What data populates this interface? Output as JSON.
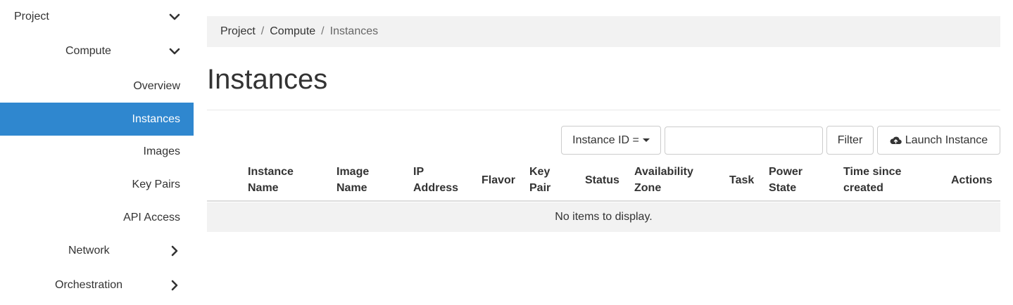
{
  "sidebar": {
    "project_label": "Project",
    "compute_label": "Compute",
    "items": [
      {
        "label": "Overview"
      },
      {
        "label": "Instances"
      },
      {
        "label": "Images"
      },
      {
        "label": "Key Pairs"
      },
      {
        "label": "API Access"
      }
    ],
    "network_label": "Network",
    "orchestration_label": "Orchestration",
    "active_item": "Instances",
    "icons": {
      "expanded": "chevron-down-icon",
      "collapsed": "chevron-right-icon"
    }
  },
  "breadcrumb": {
    "items": [
      "Project",
      "Compute",
      "Instances"
    ],
    "separator": "/"
  },
  "page": {
    "title": "Instances"
  },
  "toolbar": {
    "filter_field_label": "Instance ID =",
    "filter_value": "",
    "filter_button_label": "Filter",
    "launch_button_label": "Launch Instance",
    "launch_icon": "cloud-upload-icon"
  },
  "table": {
    "columns": [
      {
        "line1": "Instance",
        "line2": "Name"
      },
      {
        "line1": "Image",
        "line2": "Name"
      },
      {
        "line1": "IP",
        "line2": "Address"
      },
      {
        "line1": "Flavor",
        "line2": ""
      },
      {
        "line1": "Key",
        "line2": "Pair"
      },
      {
        "line1": "Status",
        "line2": ""
      },
      {
        "line1": "Availability",
        "line2": "Zone"
      },
      {
        "line1": "Task",
        "line2": ""
      },
      {
        "line1": "Power",
        "line2": "State"
      },
      {
        "line1": "Time since",
        "line2": "created"
      },
      {
        "line1": "Actions",
        "line2": ""
      }
    ],
    "empty_message": "No items to display."
  },
  "colors": {
    "active_nav": "#2f87cf",
    "breadcrumb_bg": "#f2f2f2",
    "empty_row_bg": "#f2f2f2"
  }
}
